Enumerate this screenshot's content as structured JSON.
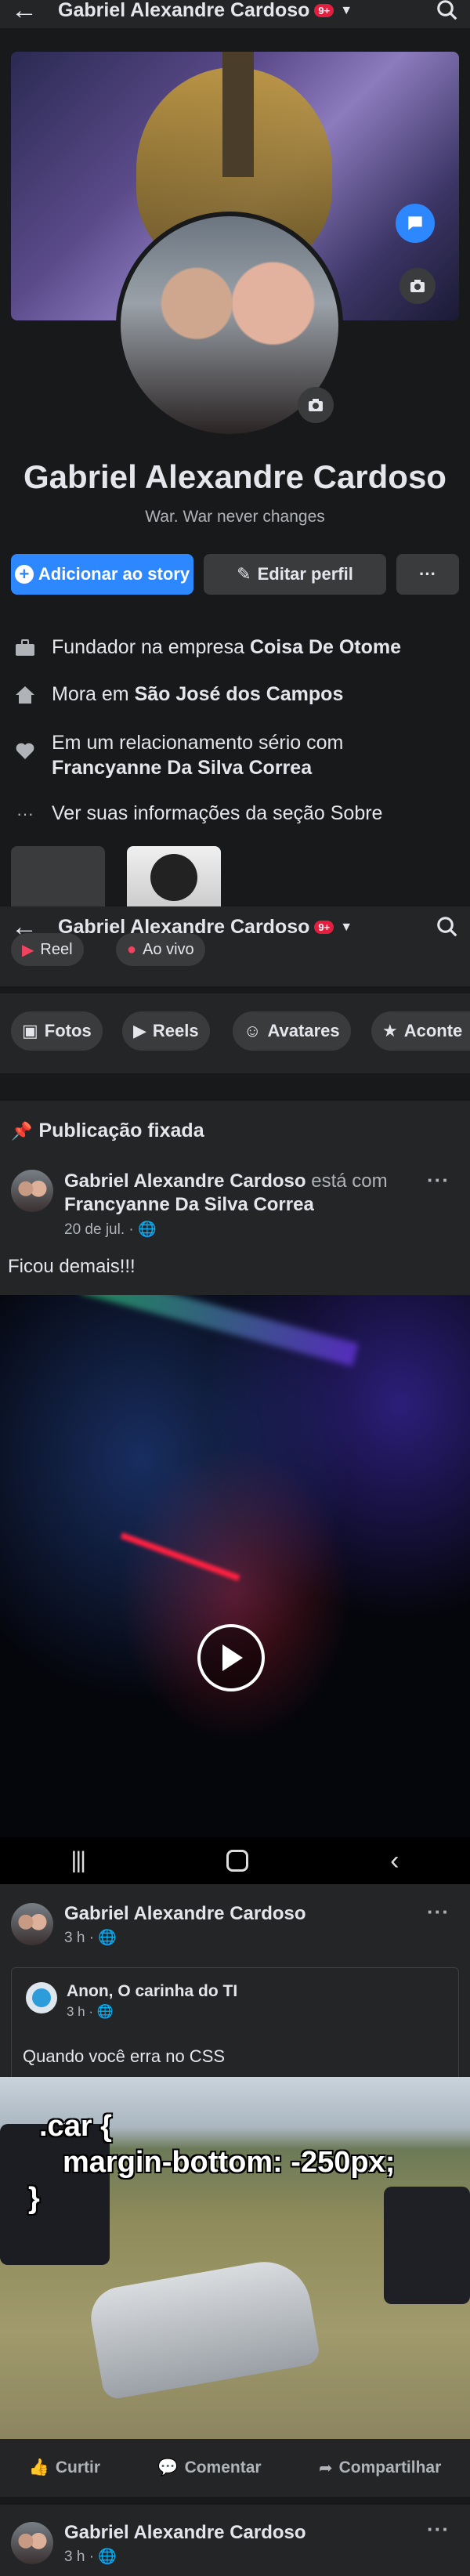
{
  "header": {
    "title": "Gabriel Alexandre Cardoso",
    "badge": "9+"
  },
  "profile": {
    "name": "Gabriel Alexandre Cardoso",
    "bio": "War. War never changes",
    "add_story_label": "Adicionar ao story",
    "edit_profile_label": "Editar perfil",
    "more_label": "···"
  },
  "details": {
    "work_prefix": "Fundador na empresa ",
    "work_company": "Coisa De Otome",
    "home_prefix": "Mora em ",
    "home_city": "São José dos Campos",
    "relationship_prefix": "Em um relacionamento sério com",
    "relationship_partner": "Francyanne Da Silva Correa",
    "about_label": "Ver suas informações da seção Sobre"
  },
  "create_row": {
    "reel_label": "Reel",
    "live_label": "Ao vivo"
  },
  "filters": {
    "photos": "Fotos",
    "reels": "Reels",
    "avatars": "Avatares",
    "events": "Aconte"
  },
  "pinned": {
    "label": "Publicação fixada",
    "author": "Gabriel Alexandre Cardoso",
    "with_text": " está com ",
    "tagged": "Francyanne Da Silva Correa",
    "date": "20 de jul. ·",
    "text": "Ficou demais!!!"
  },
  "post2": {
    "author": "Gabriel Alexandre Cardoso",
    "time": "3 h ·",
    "shared_author": "Anon, O carinha do TI",
    "shared_time": "3 h ·",
    "shared_text": "Quando você erra no CSS",
    "meme_line1": ".car {",
    "meme_line2": "margin-bottom: -250px;",
    "meme_line3": "}"
  },
  "post_actions": {
    "like": "Curtir",
    "comment": "Comentar",
    "share": "Compartilhar"
  },
  "post3": {
    "author": "Gabriel Alexandre Cardoso",
    "time": "3 h ·"
  },
  "colors": {
    "background": "#18191a",
    "surface": "#242526",
    "accent": "#2d88ff"
  }
}
